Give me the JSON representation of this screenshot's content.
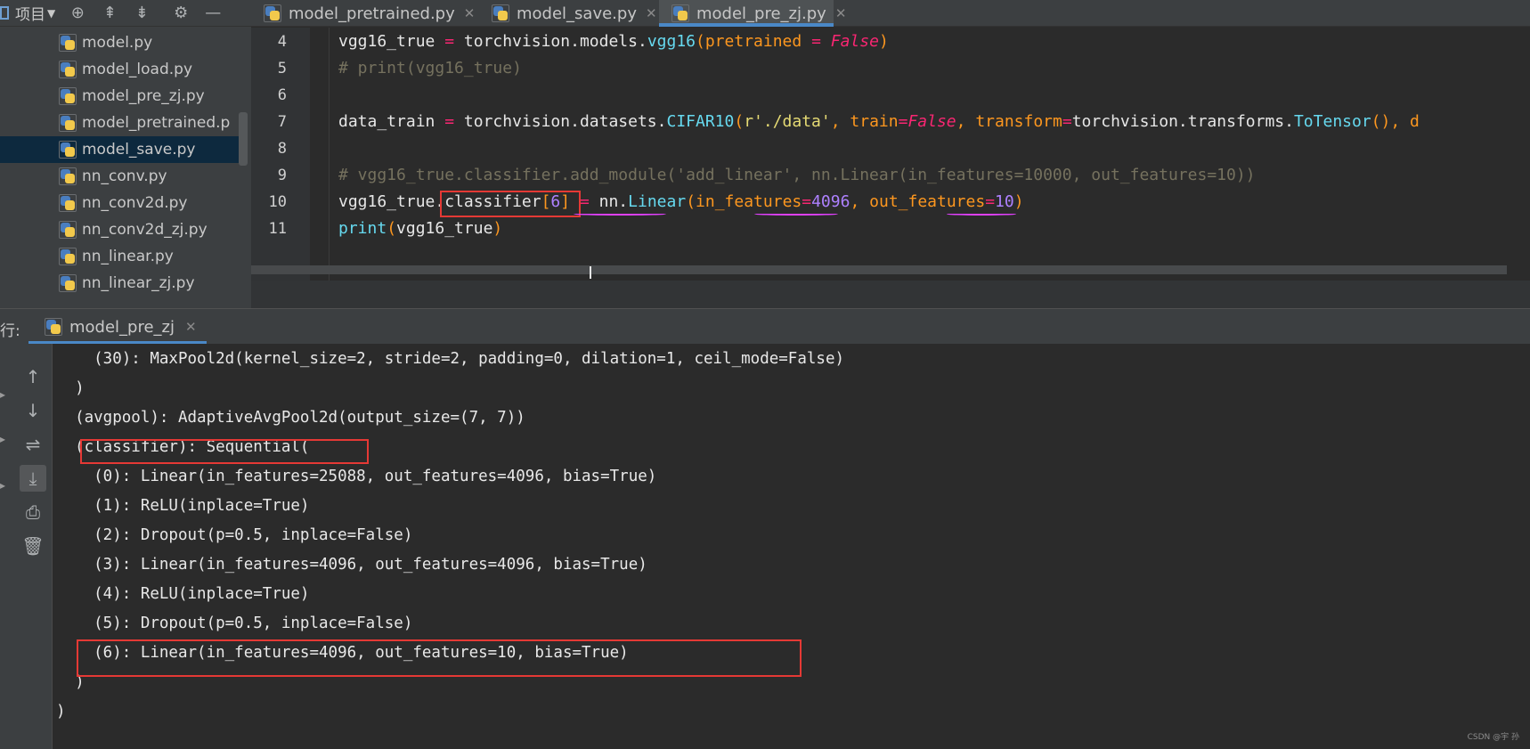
{
  "project_toolbar": {
    "label": "项目",
    "icons": [
      "target-icon",
      "expand-all-icon",
      "collapse-all-icon",
      "gear-icon",
      "minimize-icon"
    ]
  },
  "tabs": [
    {
      "label": "model_pretrained.py",
      "active": false
    },
    {
      "label": "model_save.py",
      "active": false
    },
    {
      "label": "model_pre_zj.py",
      "active": true
    }
  ],
  "project_tree": [
    {
      "label": "model.py",
      "selected": false
    },
    {
      "label": "model_load.py",
      "selected": false
    },
    {
      "label": "model_pre_zj.py",
      "selected": false
    },
    {
      "label": "model_pretrained.p",
      "selected": false
    },
    {
      "label": "model_save.py",
      "selected": true
    },
    {
      "label": "nn_conv.py",
      "selected": false
    },
    {
      "label": "nn_conv2d.py",
      "selected": false
    },
    {
      "label": "nn_conv2d_zj.py",
      "selected": false
    },
    {
      "label": "nn_linear.py",
      "selected": false
    },
    {
      "label": "nn_linear_zj.py",
      "selected": false
    }
  ],
  "editor": {
    "line_numbers": [
      "4",
      "5",
      "6",
      "7",
      "8",
      "9",
      "10",
      "11"
    ],
    "l4": {
      "a": "vgg16_true ",
      "eq": "=",
      "b": " torchvision.models.",
      "fn": "vgg16",
      "p1": "(",
      "param": "pretrained ",
      "eq2": "=",
      "sp": " ",
      "kw": "False",
      "p2": ")"
    },
    "l5": "# print(vgg16_true)",
    "l7": {
      "a": "data_train ",
      "eq": "=",
      "b": " torchvision.datasets.",
      "fn": "CIFAR10",
      "p1": "(",
      "str": "r'./data'",
      "c1": ", ",
      "param1": "train",
      "eq1": "=",
      "kw": "False",
      "c2": ", ",
      "param2": "transform",
      "eq2": "=",
      "b2": "torchvision.transforms.",
      "fn2": "ToTensor",
      "p3": "()",
      "c3": ", ",
      "trail": "d"
    },
    "l9": "# vgg16_true.classifier.add_module('add_linear', nn.Linear(in_features=10000, out_features=10))",
    "l10": {
      "a": "vgg16_true.classifier",
      "br1": "[",
      "num": "6",
      "br2": "]",
      "sp": " ",
      "eq": "=",
      "b": " nn.",
      "fn": "Linear",
      "p1": "(",
      "param1": "in_features",
      "eq1": "=",
      "num1": "4096",
      "c": ", ",
      "param2": "out_features",
      "eq2": "=",
      "num2": "10",
      "p2": ")"
    },
    "l11": {
      "fn": "print",
      "p1": "(",
      "a": "vgg16_true",
      "p2": ")"
    }
  },
  "run_panel": {
    "label": "行:",
    "tab_label": "model_pre_zj",
    "sidebar_icons": [
      "arrow-up-icon",
      "arrow-down-icon",
      "soft-wrap-icon",
      "scroll-to-end-icon",
      "print-icon",
      "trash-icon"
    ],
    "output": [
      "    (30): MaxPool2d(kernel_size=2, stride=2, padding=0, dilation=1, ceil_mode=False)",
      "  )",
      "  (avgpool): AdaptiveAvgPool2d(output_size=(7, 7))",
      "  (classifier): Sequential(",
      "    (0): Linear(in_features=25088, out_features=4096, bias=True)",
      "    (1): ReLU(inplace=True)",
      "    (2): Dropout(p=0.5, inplace=False)",
      "    (3): Linear(in_features=4096, out_features=4096, bias=True)",
      "    (4): ReLU(inplace=True)",
      "    (5): Dropout(p=0.5, inplace=False)",
      "    (6): Linear(in_features=4096, out_features=10, bias=True)",
      "  )",
      ")"
    ]
  },
  "watermark": "CSDN @宇 孙"
}
